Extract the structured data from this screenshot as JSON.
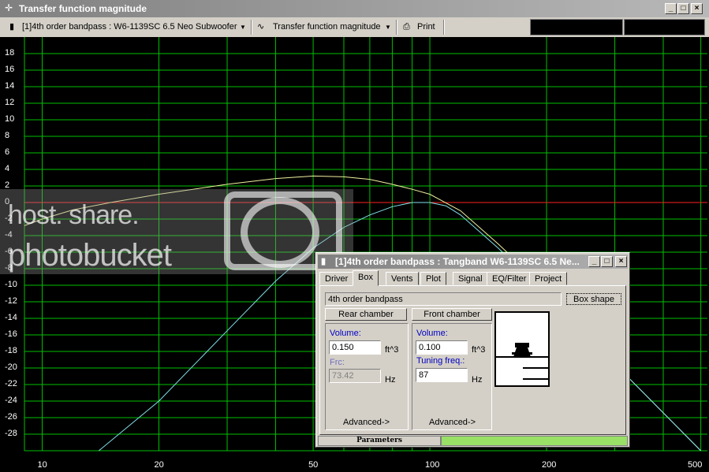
{
  "window": {
    "title": "Transfer function magnitude"
  },
  "toolbar": {
    "project_select": "[1]4th order bandpass : W6-1139SC 6.5 Neo Subwoofer",
    "plot_select": "Transfer function magnitude",
    "print_label": "Print"
  },
  "chart_data": {
    "type": "line",
    "title": "",
    "xlabel": "",
    "ylabel": "",
    "x_scale": "log",
    "xlim": [
      9,
      520
    ],
    "ylim": [
      -30,
      20
    ],
    "x_ticks": [
      "10",
      "20",
      "50",
      "100",
      "200",
      "500"
    ],
    "y_ticks": [
      "18",
      "16",
      "14",
      "12",
      "10",
      "8",
      "6",
      "4",
      "2",
      "0",
      "-2",
      "-4",
      "-6",
      "-8",
      "-10",
      "-12",
      "-14",
      "-16",
      "-18",
      "-20",
      "-22",
      "-24",
      "-26",
      "-28"
    ],
    "grid": true,
    "reference_line_y": 0,
    "colors": {
      "series_1": "#f0f0a0",
      "series_2": "#80e0e8",
      "reference": "#ff2020",
      "grid": "#00c000",
      "background": "#000000"
    },
    "series": [
      {
        "x": [
          9,
          10,
          12,
          15,
          20,
          30,
          40,
          50,
          60,
          70,
          80,
          90,
          100,
          120,
          150,
          200,
          300,
          500
        ],
        "y": [
          -2.8,
          -2.0,
          -0.9,
          0.0,
          1.0,
          2.2,
          2.9,
          3.2,
          3.1,
          2.8,
          2.2,
          1.6,
          1.0,
          -1.0,
          -5.0,
          -10.5,
          -19.5,
          -30.0
        ]
      },
      {
        "x": [
          14,
          20,
          30,
          40,
          50,
          60,
          70,
          80,
          90,
          100,
          110,
          120,
          150,
          200,
          300,
          500
        ],
        "y": [
          -30.0,
          -24.0,
          -15.5,
          -9.5,
          -5.5,
          -3.0,
          -1.5,
          -0.5,
          0.0,
          0.0,
          -0.4,
          -1.5,
          -5.5,
          -11.0,
          -19.5,
          -30.0
        ]
      }
    ]
  },
  "watermark": {
    "line1": "host. share.",
    "line2": "photobucket"
  },
  "dialog": {
    "title": "[1]4th order bandpass : Tangband W6-1139SC 6.5 Ne...",
    "tabs": [
      "Driver",
      "Box",
      "Vents",
      "Plot",
      "Signal",
      "EQ/Filter",
      "Project"
    ],
    "active_tab": "Box",
    "box_type": "4th order bandpass",
    "box_shape_button": "Box shape",
    "rear": {
      "header": "Rear chamber",
      "volume_label": "Volume:",
      "volume_value": "0.150",
      "volume_unit": "ft^3",
      "frc_label": "Frc:",
      "frc_value": "73.42",
      "frc_unit": "Hz",
      "advanced": "Advanced->"
    },
    "front": {
      "header": "Front chamber",
      "volume_label": "Volume:",
      "volume_value": "0.100",
      "volume_unit": "ft^3",
      "tuning_label": "Tuning freq.:",
      "tuning_value": "87",
      "tuning_unit": "Hz",
      "advanced": "Advanced->"
    },
    "status_label": "Parameters"
  }
}
